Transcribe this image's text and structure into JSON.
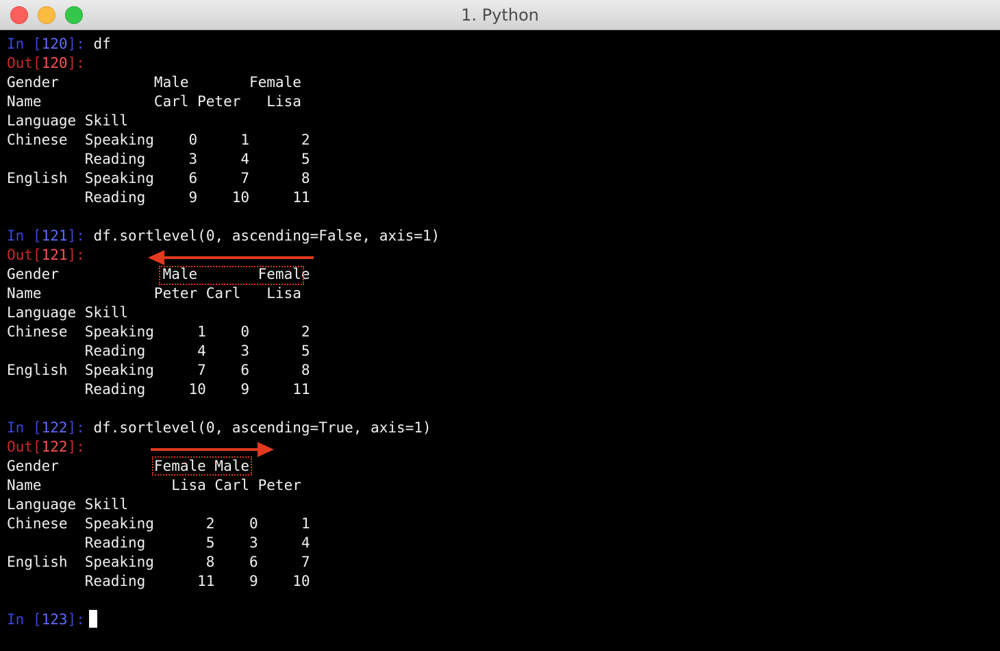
{
  "window": {
    "title": "1. Python"
  },
  "cells": [
    {
      "in_label": "In [",
      "in_num": "120",
      "in_end": "]:",
      "input": "df",
      "out_label": "Out[",
      "out_num": "120",
      "out_end": "]:",
      "output": [
        "Gender           Male       Female",
        "Name             Carl Peter   Lisa",
        "Language Skill",
        "Chinese  Speaking    0     1      2",
        "         Reading     3     4      5",
        "English  Speaking    6     7      8",
        "         Reading     9    10     11"
      ]
    },
    {
      "in_label": "In [",
      "in_num": "121",
      "in_end": "]:",
      "input": "df.sortlevel(0, ascending=False, axis=1)",
      "out_label": "Out[",
      "out_num": "121",
      "out_end": "]:",
      "output": [
        "Gender            Male       Female",
        "Name             Peter Carl   Lisa",
        "Language Skill",
        "Chinese  Speaking     1    0      2",
        "         Reading      4    3      5",
        "English  Speaking     7    6      8",
        "         Reading     10    9     11"
      ]
    },
    {
      "in_label": "In [",
      "in_num": "122",
      "in_end": "]:",
      "input": "df.sortlevel(0, ascending=True, axis=1)",
      "out_label": "Out[",
      "out_num": "122",
      "out_end": "]:",
      "output": [
        "Gender           Female Male",
        "Name               Lisa Carl Peter",
        "Language Skill",
        "Chinese  Speaking      2    0     1",
        "         Reading       5    3     4",
        "English  Speaking      8    6     7",
        "         Reading      11    9    10"
      ]
    }
  ],
  "prompt": {
    "in_label": "In [",
    "in_num": "123",
    "in_end": "]:"
  },
  "colors": {
    "prompt_in": "#3a47d8",
    "prompt_out": "#c72a2a",
    "annotation": "#e23a1e",
    "background": "#000000",
    "text": "#f2f2f2"
  }
}
